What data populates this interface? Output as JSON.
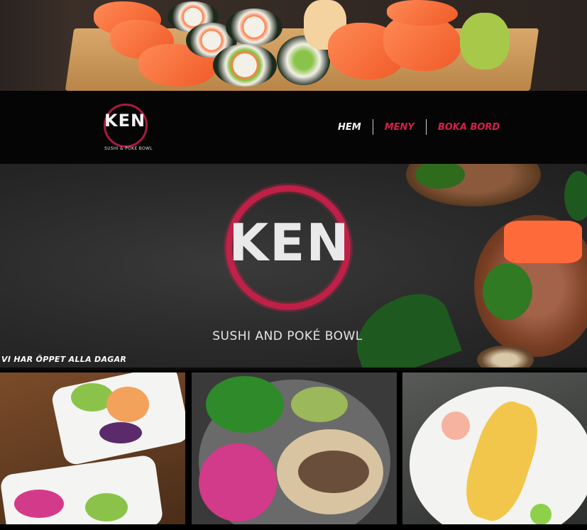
{
  "brand": {
    "logo_word": "KEN",
    "logo_tagline": "SUSHI & POKÉ BOWL"
  },
  "nav": {
    "items": [
      {
        "label": "HEM"
      },
      {
        "label": "MENY"
      },
      {
        "label": "BOKA BORD"
      }
    ]
  },
  "hero": {
    "logo_word": "KEN",
    "subtitle": "SUSHI AND POKÉ BOWL"
  },
  "notice": "VI HAR ÖPPET ALLA DAGAR",
  "colors": {
    "accent_red": "#d61f4c",
    "nav_bg": "#050505",
    "hero_bg": "#2a2a2a"
  }
}
